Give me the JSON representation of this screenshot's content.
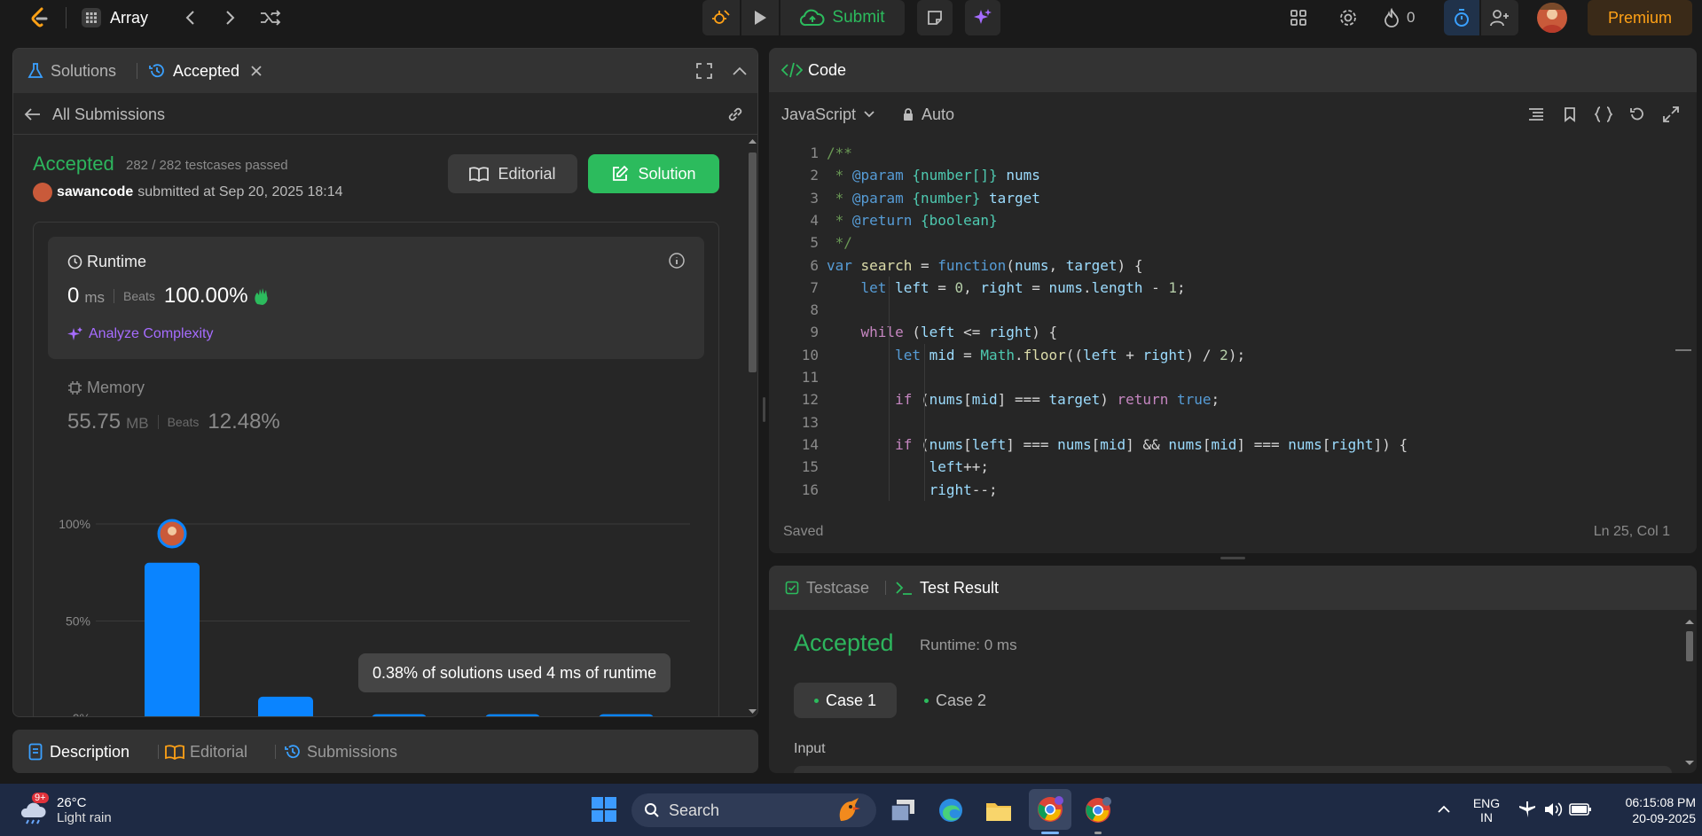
{
  "topbar": {
    "problem_list_label": "Array",
    "submit_label": "Submit",
    "streak_count": "0",
    "premium_label": "Premium"
  },
  "left_panel": {
    "tabs": {
      "solutions": "Solutions",
      "accepted": "Accepted"
    },
    "back_label": "All Submissions",
    "status": "Accepted",
    "testcases": "282 / 282 testcases passed",
    "username": "sawancode",
    "submitted_at": "submitted at Sep 20, 2025 18:14",
    "editorial_btn": "Editorial",
    "solution_btn": "Solution",
    "runtime": {
      "title": "Runtime",
      "value": "0",
      "unit": "ms",
      "beats_label": "Beats",
      "beats_value": "100.00%",
      "analyze": "Analyze Complexity"
    },
    "memory": {
      "title": "Memory",
      "value": "55.75",
      "unit": "MB",
      "beats_label": "Beats",
      "beats_value": "12.48%"
    },
    "tooltip": "0.38% of solutions used 4 ms of runtime"
  },
  "chart_data": {
    "type": "bar",
    "y_ticks": [
      "100%",
      "50%",
      "0%"
    ],
    "ylim": [
      0,
      100
    ],
    "values": [
      80,
      11,
      2,
      2,
      2
    ],
    "bar_color": "#0a84ff",
    "highlight_bar_index": 0
  },
  "bottom_left_tabs": {
    "description": "Description",
    "editorial": "Editorial",
    "submissions": "Submissions"
  },
  "code_panel": {
    "title": "Code",
    "language": "JavaScript",
    "mode": "Auto",
    "status": "Saved",
    "cursor": "Ln 25, Col 1",
    "lines": [
      "/**",
      " * @param {number[]} nums",
      " * @param {number} target",
      " * @return {boolean}",
      " */",
      "var search = function(nums, target) {",
      "    let left = 0, right = nums.length - 1;",
      "",
      "    while (left <= right) {",
      "        let mid = Math.floor((left + right) / 2);",
      "",
      "        if (nums[mid] === target) return true;",
      "",
      "        if (nums[left] === nums[mid] && nums[mid] === nums[right]) {",
      "            left++;",
      "            right--;"
    ]
  },
  "test_panel": {
    "tabs": {
      "testcase": "Testcase",
      "result": "Test Result"
    },
    "status": "Accepted",
    "runtime": "Runtime: 0 ms",
    "cases": [
      "Case 1",
      "Case 2"
    ],
    "input_label": "Input"
  },
  "taskbar": {
    "weather_temp": "26°C",
    "weather_desc": "Light rain",
    "weather_badge": "9+",
    "search_label": "Search",
    "lang_line1": "ENG",
    "lang_line2": "IN",
    "time": "06:15:08 PM",
    "date": "20-09-2025"
  },
  "colors": {
    "accent_green": "#2cbb5d",
    "accepted_green": "#2db55d",
    "premium_orange": "#ffa116",
    "link_purple": "#a66cff"
  }
}
